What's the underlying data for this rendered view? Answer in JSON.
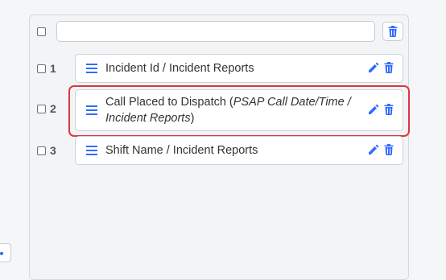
{
  "header": {
    "input_value": ""
  },
  "rows": [
    {
      "number": "1",
      "label": "Incident Id / Incident Reports"
    },
    {
      "number": "2",
      "label_main": "Call Placed to Dispatch (",
      "label_italic": "PSAP Call Date/Time / Incident Reports",
      "label_end": ")"
    },
    {
      "number": "3",
      "label": "Shift Name / Incident Reports"
    }
  ],
  "colors": {
    "accent": "#2f6bff",
    "highlight": "#dc3545"
  },
  "icons": {
    "handle": "bars-icon",
    "edit": "pencil-icon",
    "delete": "trash-icon"
  }
}
